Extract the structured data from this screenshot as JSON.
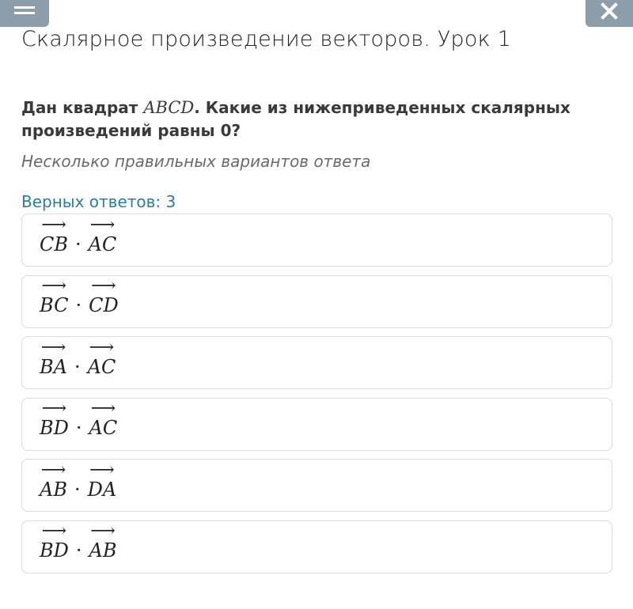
{
  "header": {
    "title": "Скалярное произведение векторов. Урок 1",
    "menu_icon": "hamburger-menu-icon",
    "close_icon": "close-icon",
    "button_color": "#8c9ea9"
  },
  "question": {
    "prefix": "Дан квадрат ",
    "math": "ABCD",
    "suffix": ". Какие из нижеприведенных скалярных произведений равны 0?",
    "hint": "Несколько правильных вариантов ответа"
  },
  "correct_count": "Верных ответов: 3",
  "options": [
    {
      "v1": "CB",
      "op": "·",
      "v2": "AC"
    },
    {
      "v1": "BC",
      "op": "·",
      "v2": "CD"
    },
    {
      "v1": "BA",
      "op": "·",
      "v2": "AC"
    },
    {
      "v1": "BD",
      "op": "·",
      "v2": "AC"
    },
    {
      "v1": "AB",
      "op": "·",
      "v2": "DA"
    },
    {
      "v1": "BD",
      "op": "·",
      "v2": "AB"
    }
  ],
  "vector_arrow": "⟶"
}
